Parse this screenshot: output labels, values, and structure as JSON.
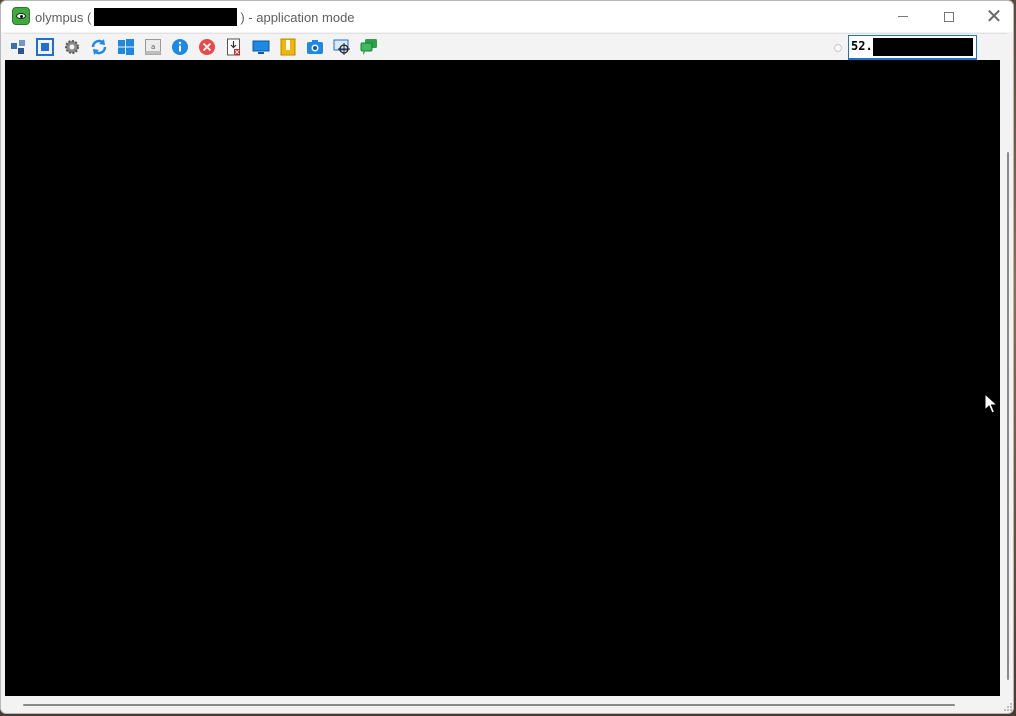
{
  "window": {
    "app_name": "olympus (",
    "title_suffix": ") - application mode"
  },
  "toolbar": {
    "buttons": [
      {
        "name": "connect-icon",
        "color": "#3a6fb0"
      },
      {
        "name": "fullscreen-icon",
        "color": "#1e6fd0"
      },
      {
        "name": "settings-gear-icon",
        "color": "#6b6b6b"
      },
      {
        "name": "refresh-icon",
        "color": "#1e88e5"
      },
      {
        "name": "windows-start-icon",
        "color": "#1e88e5"
      },
      {
        "name": "keyboard-icon",
        "color": "#888888"
      },
      {
        "name": "info-icon",
        "color": "#1e88e5"
      },
      {
        "name": "disconnect-icon",
        "color": "#e84a4a"
      },
      {
        "name": "file-transfer-icon",
        "color": "#c62828"
      },
      {
        "name": "monitor-icon",
        "color": "#1e88e5"
      },
      {
        "name": "clipboard-icon",
        "color": "#f2b600"
      },
      {
        "name": "screenshot-camera-icon",
        "color": "#1e88e5"
      },
      {
        "name": "remote-select-icon",
        "color": "#1e6fd0"
      },
      {
        "name": "chat-icon",
        "color": "#2e9e4a"
      }
    ]
  },
  "address": {
    "value_prefix": "52."
  },
  "colors": {
    "screen_background": "#000000",
    "accent": "#1a73c9"
  }
}
